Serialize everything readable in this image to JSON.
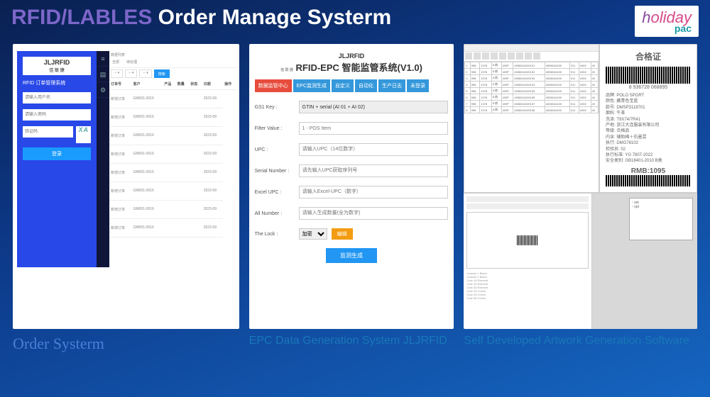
{
  "header": {
    "accent": "RFID/LABLES",
    "rest": " Order Manage Systerm",
    "logo": {
      "h": "h",
      "oliday": "oliday",
      "pac": "pac"
    }
  },
  "captions": {
    "c1": "Order Systerm",
    "c2": "EPC Data Generation System  JLJRFID",
    "c3": "Self Developed Artwork Generation Software"
  },
  "login": {
    "brand": "JLJRFID",
    "brand_sub": "佳 联 捷",
    "heading": "RFID 订单管理系统",
    "user_ph": "请输入用户名",
    "pass_ph": "请输入密码",
    "code_ph": "验证码",
    "captcha": "XA",
    "submit": "登录"
  },
  "table": {
    "breadcrumb": "数据列表",
    "tabs": [
      "全部",
      "待处理"
    ],
    "search": "搜索",
    "cols": [
      "订单号",
      "客户",
      "产品",
      "数量",
      "状态",
      "日期",
      "操作"
    ],
    "rows": [
      [
        "新增订单",
        "GM001-0016",
        "",
        "",
        "",
        "2023-09"
      ],
      [
        "新增订单",
        "GM001-0016",
        "",
        "",
        "",
        "2023-09"
      ],
      [
        "新增订单",
        "GM001-0016",
        "",
        "",
        "",
        "2023-09"
      ],
      [
        "新增订单",
        "GM001-0016",
        "",
        "",
        "",
        "2023-09"
      ],
      [
        "新增订单",
        "GM001-0016",
        "",
        "",
        "",
        "2023-09"
      ],
      [
        "新增订单",
        "GM001-0016",
        "",
        "",
        "",
        "2023-09"
      ],
      [
        "新增订单",
        "GM001-0016",
        "",
        "",
        "",
        "2023-09"
      ],
      [
        "新增订单",
        "GM001-0016",
        "",
        "",
        "",
        "2023-09"
      ]
    ]
  },
  "epc": {
    "brand": "JLJRFID",
    "brand_sub": "佳 联 捷",
    "title": "RFID-EPC 智能监管系统(V1.0)",
    "nav": [
      "数据监管中心",
      "EPC监测生成",
      "自定义",
      "自动化",
      "生产日志",
      "未登录"
    ],
    "fields": {
      "gs1": {
        "label": "GS1 Key :",
        "value": "GTIN + serial (AI 01 + AI 02)"
      },
      "filter": {
        "label": "Filter Value :",
        "value": "1 - POS Item"
      },
      "upc": {
        "label": "UPC :",
        "placeholder": "请输入UPC（14位数字）"
      },
      "serial": {
        "label": "Serial Number :",
        "placeholder": "请先输入UPC获取序列号"
      },
      "excel": {
        "label": "Excel UPC :",
        "placeholder": "请输入Excel-UPC（数字）"
      },
      "all": {
        "label": "All Number :",
        "placeholder": "请输入生成数量(全为数字)"
      },
      "lock": {
        "label": "The Lock :",
        "value": "加密",
        "btn": "编辑"
      }
    },
    "generate": "监测生成"
  },
  "artwork": {
    "label": {
      "title": "合格证",
      "barcode_num": "8 936728 068895",
      "kv": [
        "品牌: POLO SPORT",
        "颜色: 藏青色宝蓝",
        "款号: DMSP3118701",
        "面料: 牛革",
        "洗涤: T9X74/7R41",
        "产地: 浙江大连服装有限公司",
        "等级: 合格品",
        "内含: 辅助棉＋石墨混",
        "执行: DMG78102",
        "检验员: 02",
        "执行标准: YG 7807-2022",
        "安全类别: GB18401-2010 B类"
      ],
      "price": "RMB:1095"
    },
    "sheet_rows": [
      [
        "1",
        "998",
        "1378",
        "6.赫",
        "MSP",
        "4536044100101",
        "4536044100",
        "011",
        "#302",
        "40"
      ],
      [
        "2",
        "998",
        "1378",
        "6.赫",
        "MSP",
        "4536044100102",
        "4536044100",
        "011",
        "#302",
        "40"
      ],
      [
        "3",
        "998",
        "1378",
        "6.赫",
        "MSP",
        "4536044100103",
        "4536044100",
        "011",
        "#302",
        "40"
      ],
      [
        "4",
        "998",
        "1378",
        "6.赫",
        "MSP",
        "4536044100104",
        "4536044100",
        "011",
        "#302",
        "40"
      ],
      [
        "5",
        "998",
        "1378",
        "6.赫",
        "MSP",
        "4536044100105",
        "4536044100",
        "011",
        "#302",
        "40"
      ],
      [
        "6",
        "998",
        "1378",
        "6.赫",
        "MSP",
        "4536044100106",
        "4536044100",
        "011",
        "#302",
        "40"
      ],
      [
        "7",
        "998",
        "1378",
        "6.赫",
        "MSP",
        "4536044100107",
        "4536044100",
        "011",
        "#302",
        "40"
      ],
      [
        "8",
        "998",
        "1378",
        "6.赫",
        "MSP",
        "4536044100108",
        "4536044100",
        "011",
        "#302",
        "40"
      ]
    ],
    "mini_list": [
      "Custom 1 Batch",
      "Custom 2 Batch",
      "Cute 1# Element",
      "Cute 2# Element",
      "Cute 3# Element",
      "Cute 1# Colors",
      "Cute 2# Colors",
      "Cute 3# Colors"
    ]
  }
}
